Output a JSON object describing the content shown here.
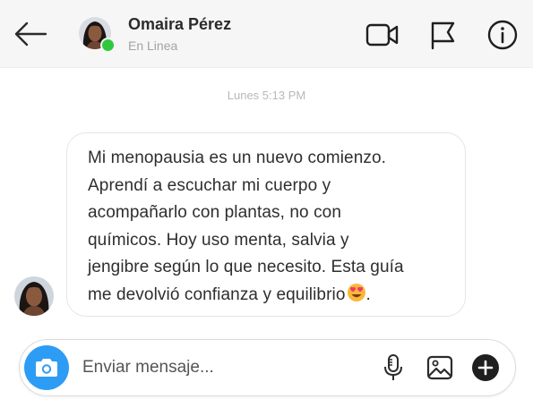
{
  "header": {
    "back_icon": "arrow-left-icon",
    "contact_name": "Omaira Pérez",
    "status": "En Linea",
    "status_color": "#31c73f",
    "actions": [
      {
        "icon": "video-camera-icon"
      },
      {
        "icon": "flag-icon"
      },
      {
        "icon": "info-icon"
      }
    ]
  },
  "conversation": {
    "timestamp": "Lunes 5:13 PM",
    "messages": [
      {
        "lines": [
          "Mi menopausia es un nuevo comienzo.",
          "Aprendí a escuchar mi cuerpo y",
          "acompañarlo con plantas, no con",
          "químicos. Hoy uso menta, salvia y",
          "jengibre según lo que necesito. Esta guía",
          "me devolvió confianza y equilibrio"
        ],
        "trailing_emoji": "heart-eyes-emoji",
        "after_emoji": "."
      }
    ]
  },
  "composer": {
    "placeholder": "Enviar mensaje...",
    "value": "",
    "camera_icon": "camera-icon",
    "camera_color": "#2d9cf5",
    "mic_icon": "microphone-icon",
    "gallery_icon": "image-icon",
    "plus_icon": "plus-circle-icon"
  }
}
